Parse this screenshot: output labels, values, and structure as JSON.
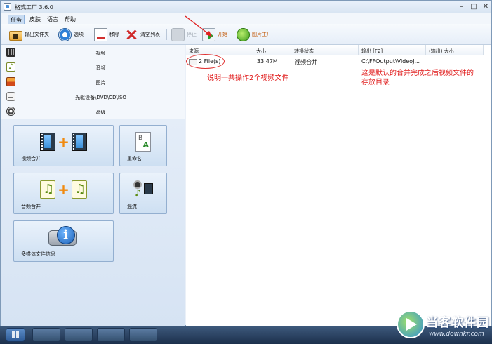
{
  "window": {
    "title": "格式工厂 3.6.0",
    "controls": {
      "minimize": "–",
      "maximize": "□",
      "close": "✕"
    }
  },
  "menu": {
    "items": [
      "任务",
      "皮肤",
      "语言",
      "帮助"
    ]
  },
  "toolbar": {
    "output_folder": "输出文件夹",
    "options": "选项",
    "remove": "移除",
    "clear_list": "清空列表",
    "stop": "停止",
    "start": "开始",
    "image_factory": "图片工厂"
  },
  "sidebar": {
    "categories": [
      "视频",
      "音频",
      "图片",
      "光驱设备\\DVD\\CD\\ISO",
      "高级"
    ],
    "tiles": {
      "video_join": "视频合并",
      "rename": "重命名",
      "audio_join": "音频合并",
      "mux": "混流",
      "media_info": "多媒体文件信息"
    }
  },
  "list": {
    "columns": [
      "来源",
      "大小",
      "转换状态",
      "输出 [F2]",
      "(输出) 大小"
    ],
    "rows": [
      {
        "source": "2 File(s)",
        "size": "33.47M",
        "status": "视频合并",
        "output": "C:\\FFOutput\\VideoJ...",
        "output_size": ""
      }
    ]
  },
  "annotations": {
    "left_note": "说明一共操作2个视频文件",
    "right_note_line1": "这是默认的合并完成之后视频文件的",
    "right_note_line2": "存放目录",
    "colors": {
      "annotation": "#e01818"
    }
  },
  "watermark": {
    "name": "当客软件园",
    "url": "www.downkr.com"
  }
}
